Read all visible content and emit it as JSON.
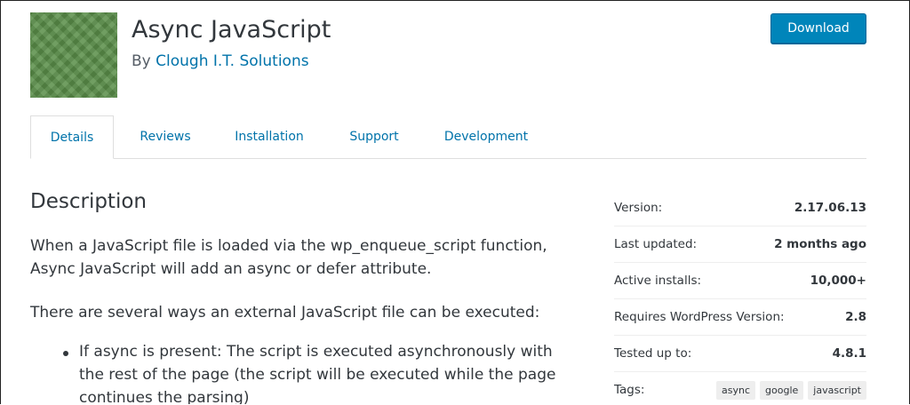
{
  "header": {
    "title": "Async JavaScript",
    "by_prefix": "By",
    "author": "Clough I.T. Solutions",
    "download_label": "Download"
  },
  "tabs": [
    {
      "label": "Details",
      "active": true
    },
    {
      "label": "Reviews",
      "active": false
    },
    {
      "label": "Installation",
      "active": false
    },
    {
      "label": "Support",
      "active": false
    },
    {
      "label": "Development",
      "active": false
    }
  ],
  "description": {
    "heading": "Description",
    "para1": "When a JavaScript file is loaded via the wp_enqueue_script function, Async JavaScript will add an async or defer attribute.",
    "para2": "There are several ways an external JavaScript file can be executed:",
    "bullets": [
      "If async is present: The script is executed asynchronously with the rest of the page (the script will be executed while the page continues the parsing)"
    ]
  },
  "meta": {
    "rows": [
      {
        "label": "Version:",
        "value": "2.17.06.13"
      },
      {
        "label": "Last updated:",
        "value": "2 months ago"
      },
      {
        "label": "Active installs:",
        "value": "10,000+"
      },
      {
        "label": "Requires WordPress Version:",
        "value": "2.8"
      },
      {
        "label": "Tested up to:",
        "value": "4.8.1"
      }
    ],
    "tags_label": "Tags:",
    "tags": [
      "async",
      "google",
      "javascript"
    ]
  },
  "colors": {
    "link": "#0073aa",
    "button": "#0085ba",
    "banner": "#5b8f4a"
  }
}
